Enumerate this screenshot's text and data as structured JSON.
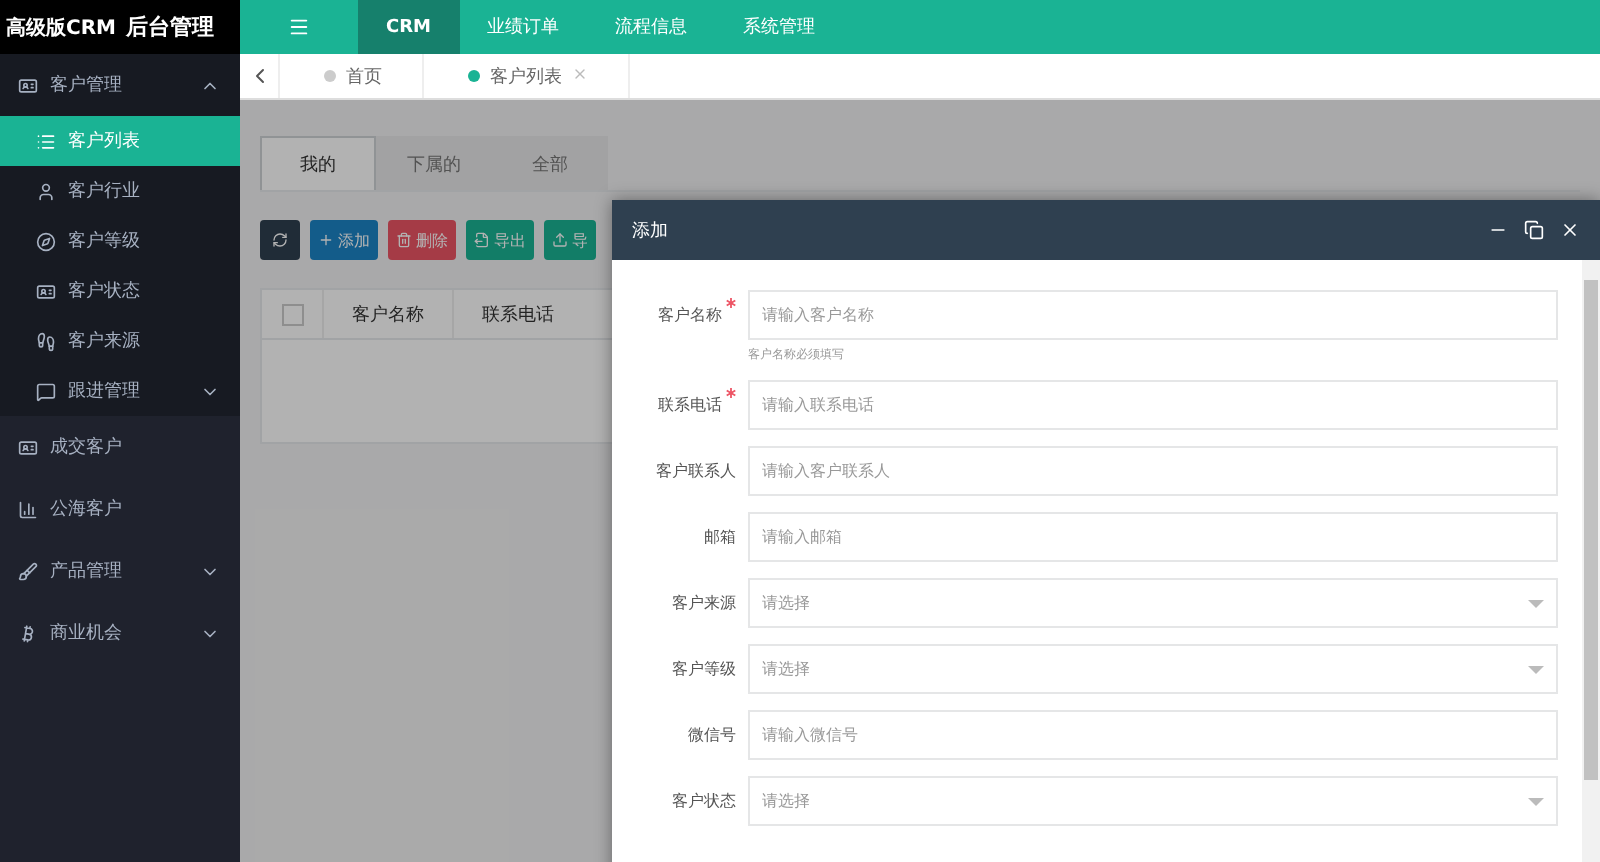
{
  "logo": {
    "title": "高级版CRM",
    "subtitle": "后台管理"
  },
  "sidebar": {
    "items": [
      {
        "label": "客户管理",
        "expanded": true,
        "children": [
          {
            "label": "客户列表",
            "selected": true
          },
          {
            "label": "客户行业",
            "selected": false
          },
          {
            "label": "客户等级",
            "selected": false
          },
          {
            "label": "客户状态",
            "selected": false
          },
          {
            "label": "客户来源",
            "selected": false
          },
          {
            "label": "跟进管理",
            "selected": false,
            "expanded": false
          }
        ]
      },
      {
        "label": "成交客户"
      },
      {
        "label": "公海客户"
      },
      {
        "label": "产品管理",
        "expanded": false
      },
      {
        "label": "商业机会",
        "expanded": false
      }
    ]
  },
  "top_nav": {
    "items": [
      {
        "label": "CRM",
        "selected": true
      },
      {
        "label": "业绩订单",
        "selected": false
      },
      {
        "label": "流程信息",
        "selected": false
      },
      {
        "label": "系统管理",
        "selected": false
      }
    ]
  },
  "page_tabs": [
    {
      "label": "首页",
      "selected": false,
      "closable": false
    },
    {
      "label": "客户列表",
      "selected": true,
      "closable": true
    }
  ],
  "content": {
    "tabs": [
      {
        "label": "我的",
        "selected": true
      },
      {
        "label": "下属的",
        "selected": false
      },
      {
        "label": "全部",
        "selected": false
      }
    ],
    "buttons": [
      {
        "kind": "refresh"
      },
      {
        "label": "添加",
        "kind": "add"
      },
      {
        "label": "删除",
        "kind": "delete"
      },
      {
        "label": "导出",
        "kind": "export"
      },
      {
        "label": "导",
        "kind": "import"
      }
    ],
    "table": {
      "select_all_checked": false,
      "columns": [
        "客户名称",
        "联系电话"
      ]
    }
  },
  "dialog": {
    "title": "添加",
    "fields": [
      {
        "label": "客户名称",
        "required": true,
        "kind": "input",
        "placeholder": "请输入客户名称",
        "hint": "客户名称必须填写"
      },
      {
        "label": "联系电话",
        "required": true,
        "kind": "input",
        "placeholder": "请输入联系电话"
      },
      {
        "label": "客户联系人",
        "required": false,
        "kind": "input",
        "placeholder": "请输入客户联系人"
      },
      {
        "label": "邮箱",
        "required": false,
        "kind": "input",
        "placeholder": "请输入邮箱"
      },
      {
        "label": "客户来源",
        "required": false,
        "kind": "select",
        "placeholder": "请选择"
      },
      {
        "label": "客户等级",
        "required": false,
        "kind": "select",
        "placeholder": "请选择"
      },
      {
        "label": "微信号",
        "required": false,
        "kind": "input",
        "placeholder": "请输入微信号"
      },
      {
        "label": "客户状态",
        "required": false,
        "kind": "select",
        "placeholder": "请选择"
      }
    ]
  }
}
